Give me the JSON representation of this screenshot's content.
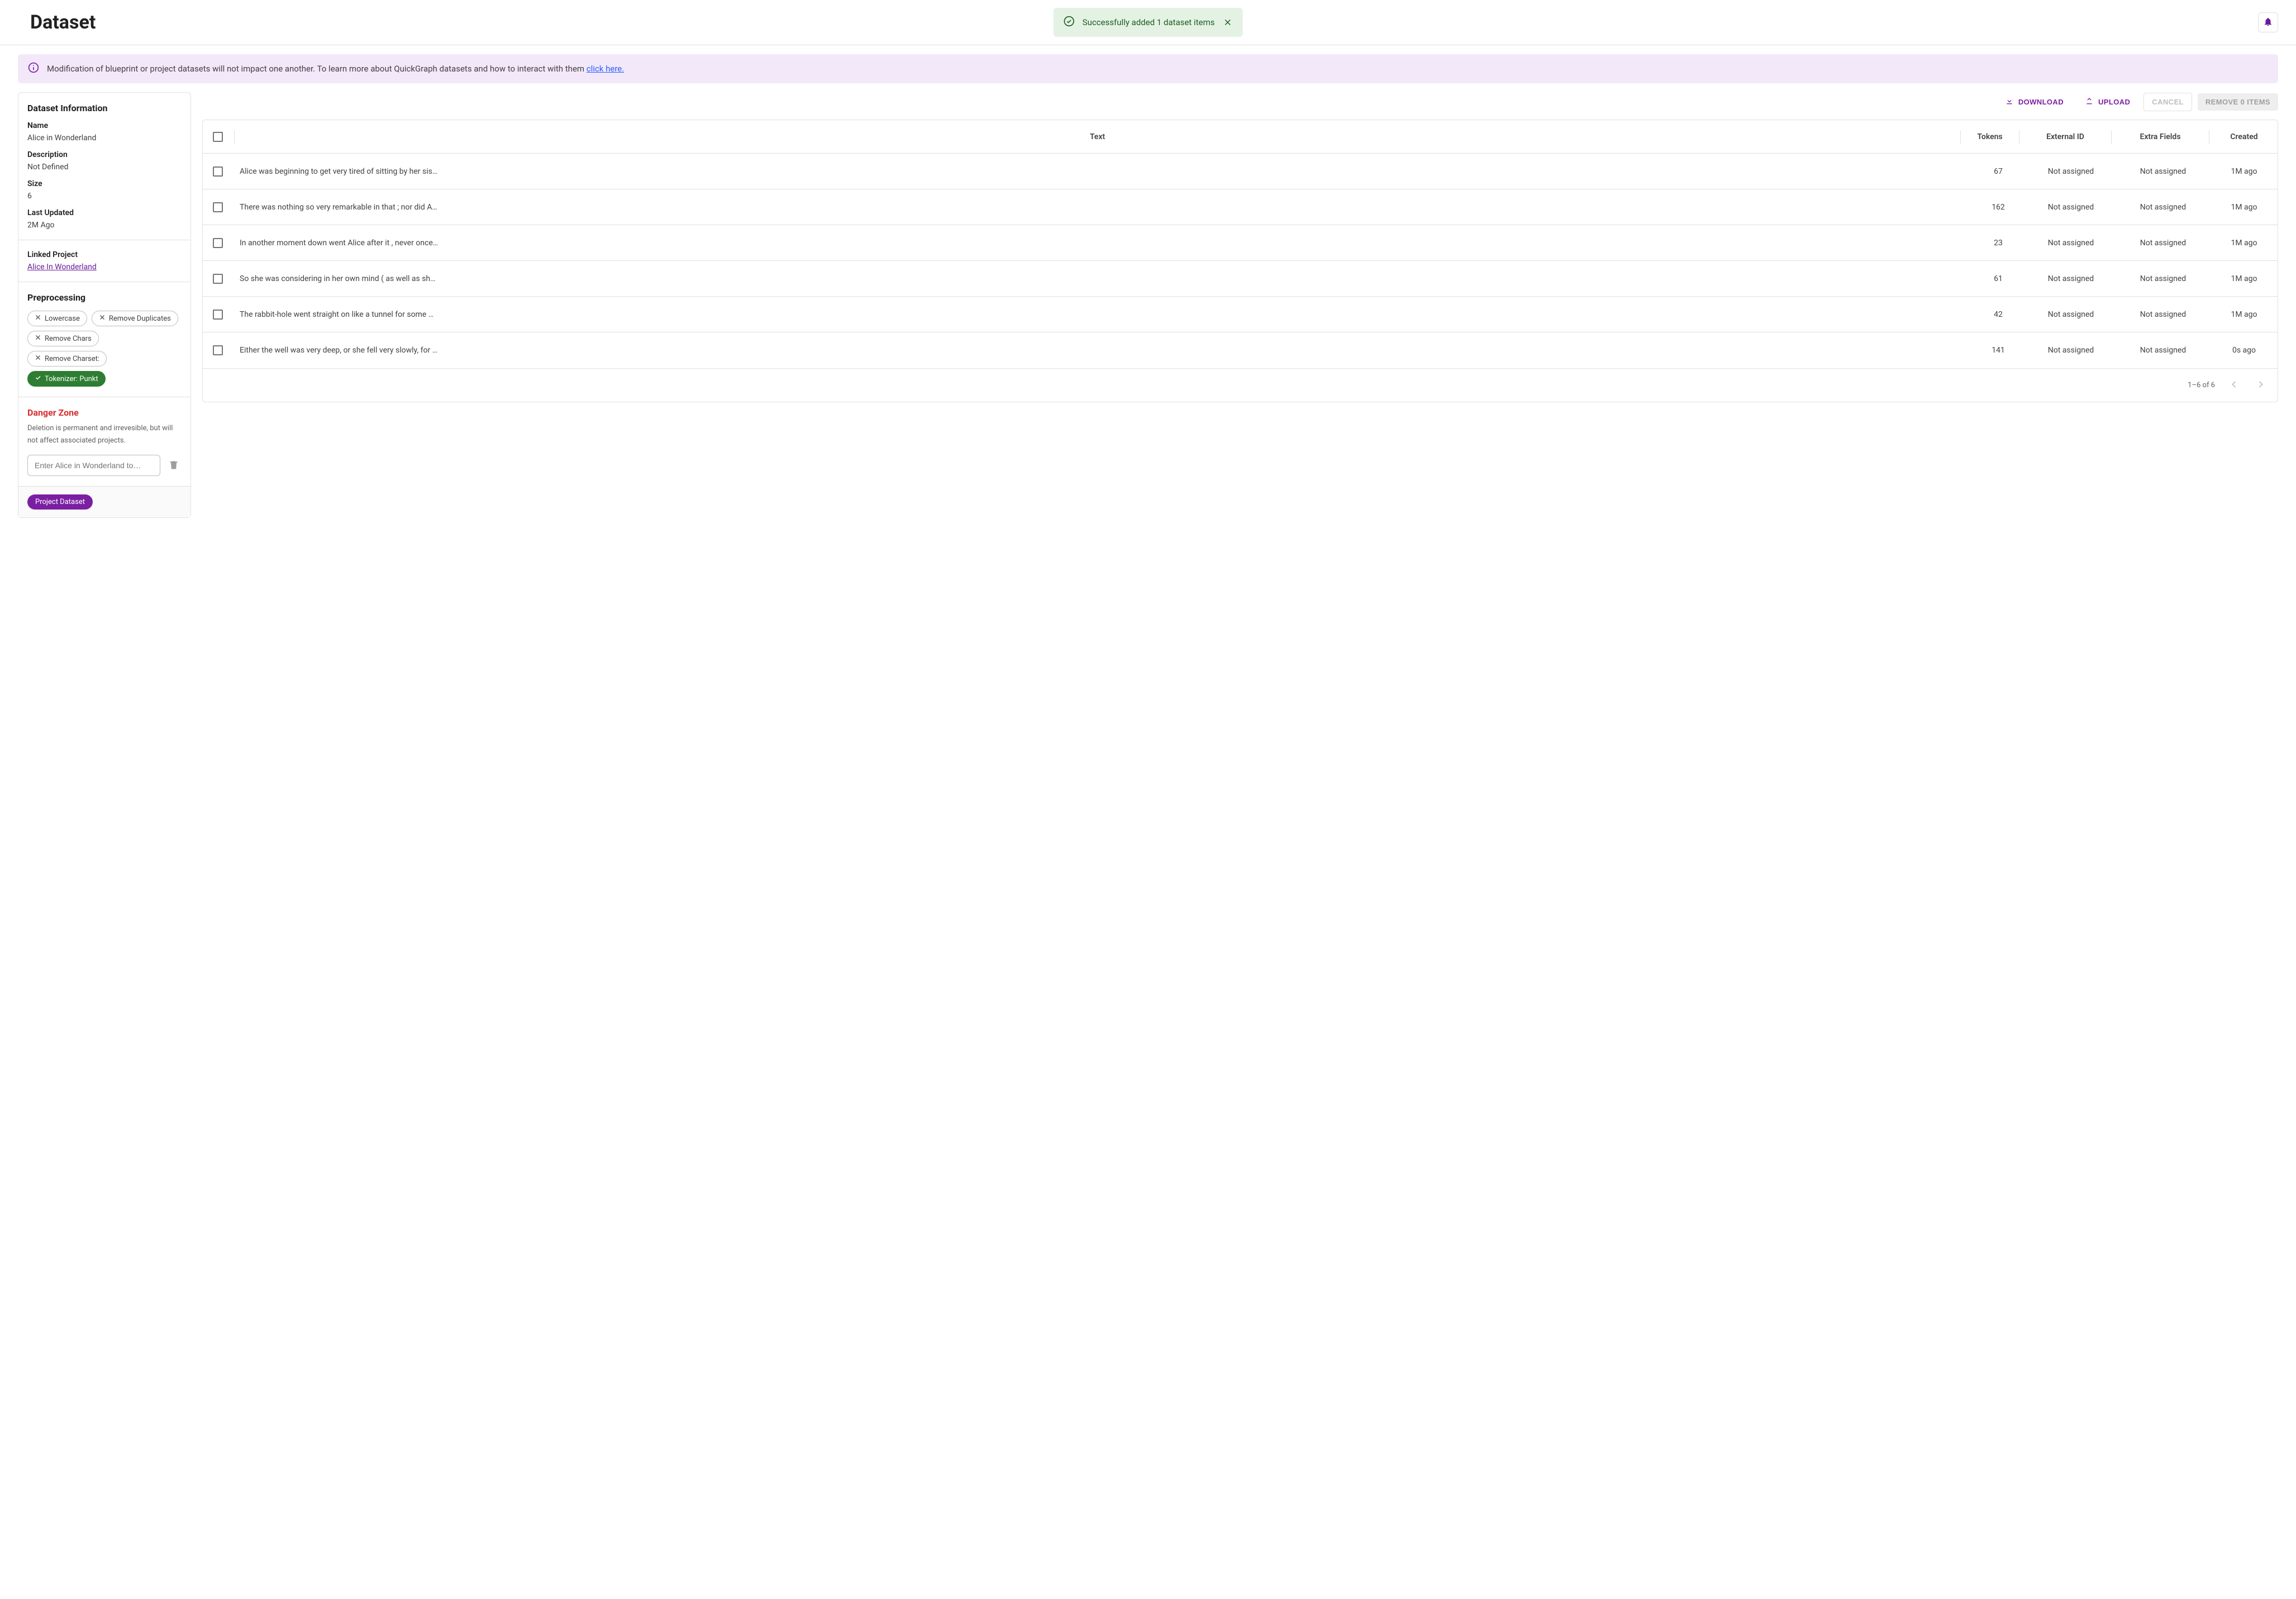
{
  "pageTitle": "Dataset",
  "toast": {
    "text": "Successfully added 1 dataset items"
  },
  "infoBanner": {
    "text": "Modification of blueprint or project datasets will not impact one another. To learn more about QuickGraph datasets and how to interact with them ",
    "linkText": "click here."
  },
  "sidebar": {
    "infoTitle": "Dataset Information",
    "fields": {
      "nameLabel": "Name",
      "nameValue": "Alice in Wonderland",
      "descLabel": "Description",
      "descValue": "Not Defined",
      "sizeLabel": "Size",
      "sizeValue": "6",
      "updatedLabel": "Last Updated",
      "updatedValue": "2M Ago",
      "linkedLabel": "Linked Project",
      "linkedValue": "Alice In Wonderland"
    },
    "preprocTitle": "Preprocessing",
    "chips": {
      "lowercase": "Lowercase",
      "removeDup": "Remove Duplicates",
      "removeChars": "Remove Chars",
      "removeCharset": "Remove Charset:",
      "tokenizer": "Tokenizer: Punkt"
    },
    "danger": {
      "title": "Danger Zone",
      "text": "Deletion is permanent and irrevesible, but will not affect associated projects.",
      "placeholder": "Enter Alice in Wonderland to…"
    },
    "footerBadge": "Project Dataset"
  },
  "toolbar": {
    "download": "DOWNLOAD",
    "upload": "UPLOAD",
    "cancel": "CANCEL",
    "remove": "REMOVE 0 ITEMS"
  },
  "table": {
    "headers": {
      "text": "Text",
      "tokens": "Tokens",
      "externalId": "External ID",
      "extraFields": "Extra Fields",
      "created": "Created"
    },
    "rows": [
      {
        "text": "Alice was beginning to get very tired of sitting by her sis…",
        "tokens": "67",
        "ext": "Not assigned",
        "extra": "Not assigned",
        "created": "1M ago"
      },
      {
        "text": "There was nothing so very remarkable in that ; nor did A…",
        "tokens": "162",
        "ext": "Not assigned",
        "extra": "Not assigned",
        "created": "1M ago"
      },
      {
        "text": "In another moment down went Alice after it , never once…",
        "tokens": "23",
        "ext": "Not assigned",
        "extra": "Not assigned",
        "created": "1M ago"
      },
      {
        "text": "So she was considering in her own mind ( as well as sh…",
        "tokens": "61",
        "ext": "Not assigned",
        "extra": "Not assigned",
        "created": "1M ago"
      },
      {
        "text": "The rabbit-hole went straight on like a tunnel for some …",
        "tokens": "42",
        "ext": "Not assigned",
        "extra": "Not assigned",
        "created": "1M ago"
      },
      {
        "text": "Either the well was very deep, or she fell very slowly, for …",
        "tokens": "141",
        "ext": "Not assigned",
        "extra": "Not assigned",
        "created": "0s ago"
      }
    ],
    "pagination": "1–6 of 6"
  }
}
